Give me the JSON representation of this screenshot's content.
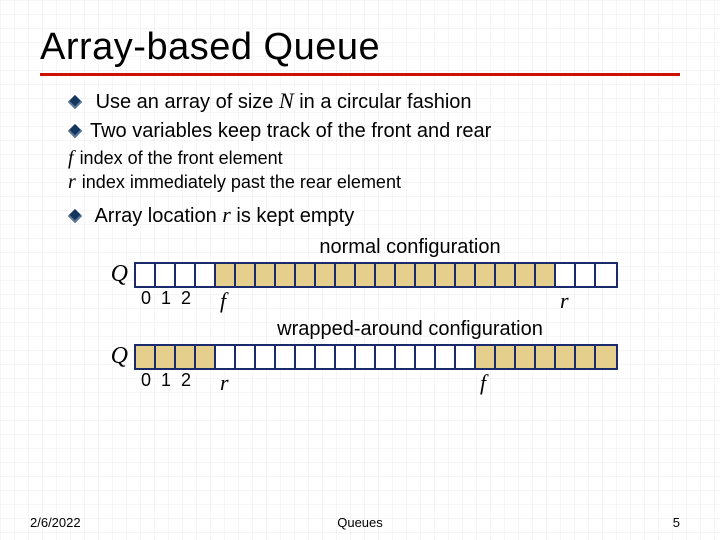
{
  "title": "Array-based Queue",
  "bullets": {
    "b1_pre": "Use an array of size ",
    "b1_var": "N",
    "b1_post": " in a circular fashion",
    "b2": "Two variables keep track of the front and rear",
    "sub_f_var": "f",
    "sub_f_text": "index of the front element",
    "sub_r_var": "r",
    "sub_r_text": "index immediately past the rear element",
    "b3_pre": "Array location ",
    "b3_var": "r",
    "b3_post": " is kept empty"
  },
  "fig": {
    "normal_caption": "normal configuration",
    "wrapped_caption": "wrapped-around configuration",
    "Q": "Q",
    "idx0": "0",
    "idx1": "1",
    "idx2": "2",
    "f": "f",
    "r": "r"
  },
  "footer": {
    "date": "2/6/2022",
    "topic": "Queues",
    "page": "5"
  },
  "chart_data": {
    "type": "table",
    "array_length": 24,
    "normal": {
      "f_index": 4,
      "r_index": 21,
      "filled_range": [
        4,
        20
      ]
    },
    "wrapped": {
      "f_index": 17,
      "r_index": 4,
      "filled_ranges": [
        [
          0,
          3
        ],
        [
          17,
          23
        ]
      ]
    },
    "index_labels_shown": [
      0,
      1,
      2
    ]
  }
}
